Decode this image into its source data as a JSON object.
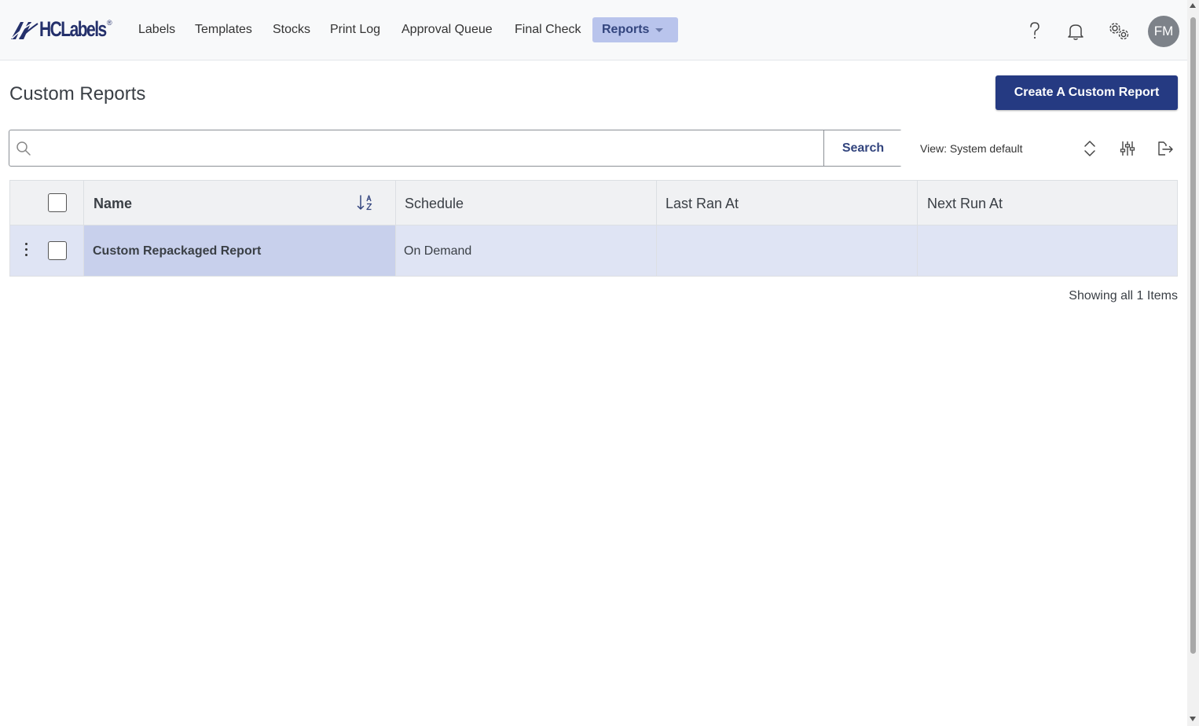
{
  "brand": {
    "name": "HCLabels",
    "reg": "®"
  },
  "nav": {
    "items": [
      {
        "label": "Labels"
      },
      {
        "label": "Templates"
      },
      {
        "label": "Stocks"
      },
      {
        "label": "Print Log"
      },
      {
        "label": "Approval Queue"
      },
      {
        "label": "Final Check"
      }
    ],
    "active": {
      "label": "Reports"
    }
  },
  "header_icons": [
    "help-icon",
    "bell-icon",
    "settings-icon"
  ],
  "user": {
    "initials": "FM"
  },
  "page": {
    "title": "Custom Reports",
    "create_label": "Create A Custom Report"
  },
  "search": {
    "value": "",
    "placeholder": "",
    "button_label": "Search"
  },
  "view": {
    "label": "View: System default"
  },
  "table": {
    "columns": [
      {
        "label": "Name"
      },
      {
        "label": "Schedule"
      },
      {
        "label": "Last Ran At"
      },
      {
        "label": "Next Run At"
      }
    ],
    "rows": [
      {
        "name": "Custom Repackaged Report",
        "schedule": "On Demand",
        "last_ran_at": "",
        "next_run_at": ""
      }
    ]
  },
  "footer": {
    "showing": "Showing all 1 Items"
  },
  "colors": {
    "brand": "#24306b",
    "primary_button": "#253a82",
    "active_nav": "#b9c4ec",
    "row_selected": "#dfe4f4",
    "cell_selected": "#c8d0ec"
  }
}
